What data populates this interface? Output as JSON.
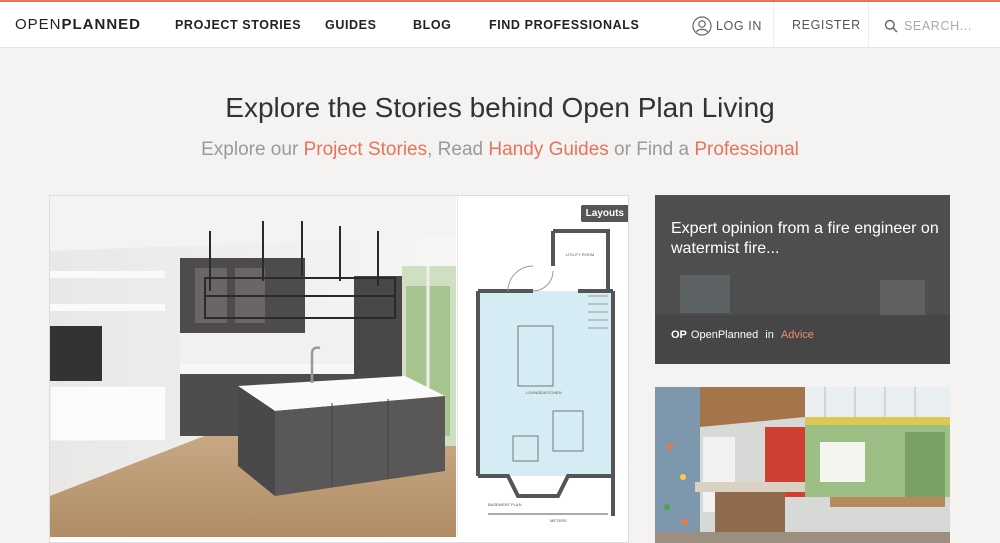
{
  "header": {
    "logo_part1": "OPEN",
    "logo_part2": "PLANNED",
    "nav": [
      "PROJECT STORIES",
      "GUIDES",
      "BLOG",
      "FIND PROFESSIONALS"
    ],
    "login_label": "LOG IN",
    "register_label": "REGISTER",
    "search_placeholder": "SEARCH..."
  },
  "hero": {
    "title": "Explore the Stories behind Open Plan Living",
    "sub_prefix": "Explore our ",
    "sub_link1": "Project Stories",
    "sub_mid": ", Read ",
    "sub_link2": "Handy Guides",
    "sub_mid2": " or Find a ",
    "sub_link3": "Professional"
  },
  "main_card": {
    "badge": "Layouts",
    "plan_labels": {
      "utility": "UTILITY ROOM",
      "lounge": "LOUNGE/KITCHEN",
      "basement": "BASEMENT PLAN",
      "meters": "METERS"
    }
  },
  "side_card": {
    "title": "Expert opinion from a fire engineer on watermist fire...",
    "author_logo": "OP",
    "author": "OpenPlanned",
    "in_word": " in ",
    "category": "Advice"
  },
  "colors": {
    "accent": "#e8735a",
    "card_dark": "#505050"
  }
}
